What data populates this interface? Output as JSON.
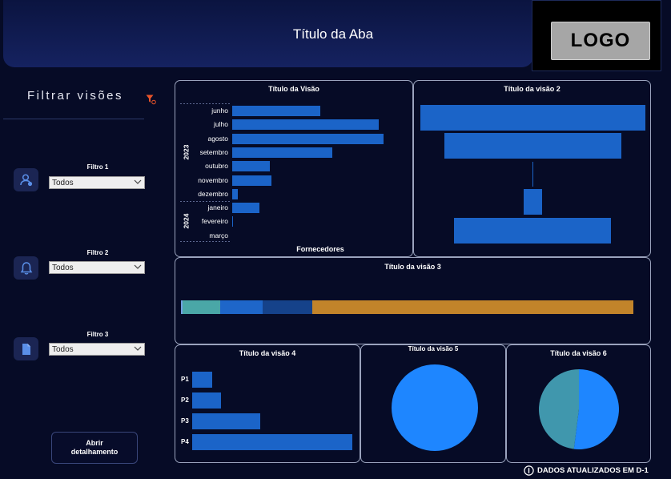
{
  "header": {
    "title": "Título da Aba",
    "logo": "LOGO"
  },
  "sidebar": {
    "title": "Filtrar visões",
    "filters": [
      {
        "label": "Filtro 1",
        "value": "Todos",
        "icon": "user-settings-icon"
      },
      {
        "label": "Filtro 2",
        "value": "Todos",
        "icon": "bell-icon"
      },
      {
        "label": "Filtro 3",
        "value": "Todos",
        "icon": "document-icon"
      }
    ],
    "open_button": "Abrir detalhamento"
  },
  "footer": {
    "status": "DADOS ATUALIZADOS EM D-1"
  },
  "colors": {
    "bar": "#1b64c8",
    "funnel_icon": "#e8542a",
    "pie_blue": "#1e86ff",
    "pie_teal": "#4097ad"
  },
  "chart_data": [
    {
      "id": "visao1",
      "type": "bar",
      "orientation": "horizontal",
      "title": "Título da Visão",
      "xlabel": "Fornecedores",
      "groups": [
        {
          "year": "2023",
          "months": [
            "junho",
            "julho",
            "agosto",
            "setembro",
            "outubro",
            "novembro",
            "dezembro"
          ]
        },
        {
          "year": "2024",
          "months": [
            "janeiro",
            "fevereiro",
            "março"
          ]
        }
      ],
      "categories": [
        "junho",
        "julho",
        "agosto",
        "setembro",
        "outubro",
        "novembro",
        "dezembro",
        "janeiro",
        "fevereiro",
        "março"
      ],
      "values": [
        110,
        183,
        189,
        125,
        47,
        49,
        7,
        34,
        1,
        0
      ]
    },
    {
      "id": "visao2",
      "type": "bar",
      "orientation": "funnel",
      "title": "Título da visão 2",
      "values": [
        281,
        221,
        0.5,
        23,
        196
      ]
    },
    {
      "id": "visao3",
      "type": "bar",
      "orientation": "stacked-100",
      "title": "Título da visão 3",
      "series": [
        {
          "value": 0.3,
          "color": "#6f9fe0"
        },
        {
          "value": 8.4,
          "color": "#4aa7a7"
        },
        {
          "value": 9.4,
          "color": "#1e66c9"
        },
        {
          "value": 11.0,
          "color": "#15428a"
        },
        {
          "value": 70.9,
          "color": "#c2842a"
        }
      ]
    },
    {
      "id": "visao4",
      "type": "bar",
      "orientation": "horizontal",
      "title": "Título da visão 4",
      "categories": [
        "P1",
        "P2",
        "P3",
        "P4"
      ],
      "values": [
        25,
        36,
        85,
        200
      ]
    },
    {
      "id": "visao5",
      "type": "pie",
      "title": "Título da visão 5",
      "values": [
        100
      ],
      "colors": [
        "#1e86ff"
      ]
    },
    {
      "id": "visao6",
      "type": "pie",
      "title": "Título da visão 6",
      "values": [
        52,
        48
      ],
      "colors": [
        "#1e86ff",
        "#4097ad"
      ]
    }
  ]
}
